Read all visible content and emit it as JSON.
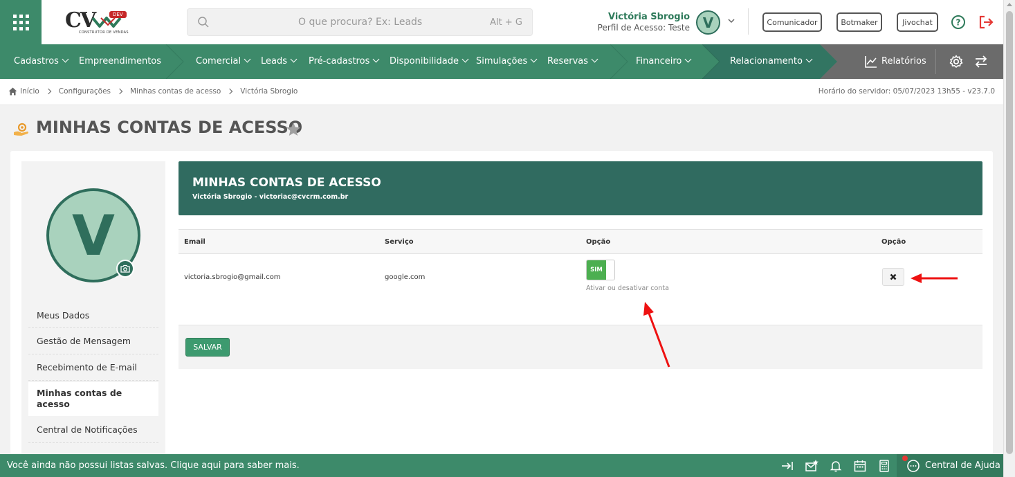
{
  "header": {
    "logo_text": "CV",
    "logo_badge": "DEV",
    "logo_subtitle": "CONSTRUTOR DE VENDAS",
    "search_placeholder": "O que procura? Ex: Leads",
    "search_shortcut": "Alt + G",
    "user_name": "Victória Sbrogio",
    "user_role": "Perfil de Acesso: Teste",
    "user_initial": "V",
    "buttons": [
      "Comunicador",
      "Botmaker",
      "Jivochat"
    ]
  },
  "nav": {
    "items": [
      {
        "label": "Cadastros",
        "caret": true
      },
      {
        "label": "Empreendimentos",
        "caret": false
      },
      {
        "label": "Comercial",
        "caret": true
      },
      {
        "label": "Leads",
        "caret": true
      },
      {
        "label": "Pré-cadastros",
        "caret": true
      },
      {
        "label": "Disponibilidade",
        "caret": true
      },
      {
        "label": "Simulações",
        "caret": true
      },
      {
        "label": "Reservas",
        "caret": true
      },
      {
        "label": "Financeiro",
        "caret": true
      },
      {
        "label": "Relacionamento",
        "caret": true
      },
      {
        "label": "Relatórios",
        "caret": false
      }
    ],
    "colors": {
      "green": "#3d8a6a",
      "dark": "#2f6e5c",
      "gray": "#6b6b6b"
    }
  },
  "breadcrumb": {
    "items": [
      "Início",
      "Configurações",
      "Minhas contas de acesso",
      "Victória Sbrogio"
    ],
    "server_time": "Horário do servidor: 05/07/2023 13h55 - v23.7.0"
  },
  "page": {
    "title": "MINHAS CONTAS DE ACESSO"
  },
  "sidebar": {
    "avatar_initial": "V",
    "items": [
      {
        "label": "Meus Dados",
        "active": false
      },
      {
        "label": "Gestão de Mensagem",
        "active": false
      },
      {
        "label": "Recebimento de E-mail",
        "active": false
      },
      {
        "label": "Minhas contas de acesso",
        "active": true
      },
      {
        "label": "Central de Notificações",
        "active": false
      }
    ]
  },
  "panel": {
    "title": "MINHAS CONTAS DE ACESSO",
    "subtitle": "Victória Sbrogio - victoriac@cvcrm.com.br",
    "columns": [
      "Email",
      "Serviço",
      "Opção",
      "Opção"
    ],
    "rows": [
      {
        "email": "victoria.sbrogio@gmail.com",
        "service": "google.com",
        "toggle_label": "SIM",
        "toggle_hint": "Ativar ou desativar conta"
      }
    ],
    "save_label": "SALVAR"
  },
  "bottom": {
    "message": "Você ainda não possui listas salvas. Clique aqui para saber mais.",
    "help_center": "Central de Ajuda"
  }
}
